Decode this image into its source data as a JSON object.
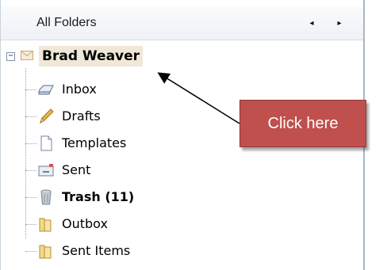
{
  "header": {
    "title": "All Folders",
    "prev_glyph": "◂",
    "next_glyph": "▸"
  },
  "account": {
    "expander": "−",
    "name": "Brad Weaver",
    "icon": "envelope-icon"
  },
  "folders": [
    {
      "label": "Inbox",
      "icon": "inbox-tray-icon",
      "bold": false
    },
    {
      "label": "Drafts",
      "icon": "pencil-icon",
      "bold": false
    },
    {
      "label": "Templates",
      "icon": "document-icon",
      "bold": false
    },
    {
      "label": "Sent",
      "icon": "sent-envelope-icon",
      "bold": false
    },
    {
      "label": "Trash (11)",
      "icon": "trash-can-icon",
      "bold": true
    },
    {
      "label": "Outbox",
      "icon": "folder-icon",
      "bold": false
    },
    {
      "label": "Sent Items",
      "icon": "folder-icon",
      "bold": false
    }
  ],
  "callout": {
    "text": "Click here",
    "color": "#c0504d"
  }
}
